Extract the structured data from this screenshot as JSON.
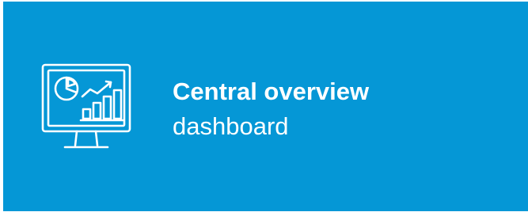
{
  "card": {
    "title": "Central overview",
    "subtitle": "dashboard",
    "icon": "monitor-chart-icon",
    "background_color": "#0597d6",
    "text_color": "#ffffff"
  }
}
